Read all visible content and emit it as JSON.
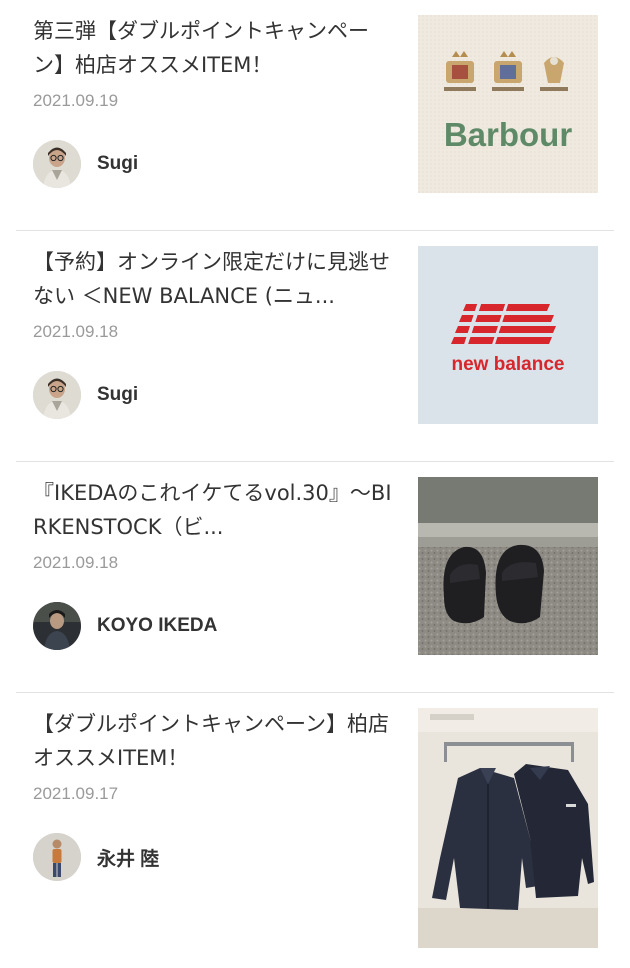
{
  "articles": [
    {
      "title": "第三弾【ダブルポイントキャンペーン】柏店オススメITEM！",
      "date": "2021.09.19",
      "author": "Sugi",
      "thumbnail_brand": "Barbour",
      "thumbnail_colors": {
        "bg": "#efe9df",
        "logo": "#5f8a68"
      }
    },
    {
      "title": "【予約】オンライン限定だけに見逃せない ＜NEW BALANCE (ニュ...",
      "date": "2021.09.18",
      "author": "Sugi",
      "thumbnail_brand": "new balance",
      "thumbnail_colors": {
        "bg": "#d9e3e9",
        "logo": "#d7262c"
      }
    },
    {
      "title": "『IKEDAのこれイケてるvol.30』〜BIRKENSTOCK（ビ...",
      "date": "2021.09.18",
      "author": "KOYO IKEDA",
      "thumbnail_brand": "",
      "thumbnail_colors": {
        "bg": "#8f8c84",
        "logo": "#1f1f22"
      }
    },
    {
      "title": "【ダブルポイントキャンペーン】柏店オススメITEM！",
      "date": "2021.09.17",
      "author": "永井 陸",
      "thumbnail_brand": "",
      "thumbnail_colors": {
        "bg": "#e9e4dc",
        "logo": "#2b3040"
      }
    }
  ]
}
